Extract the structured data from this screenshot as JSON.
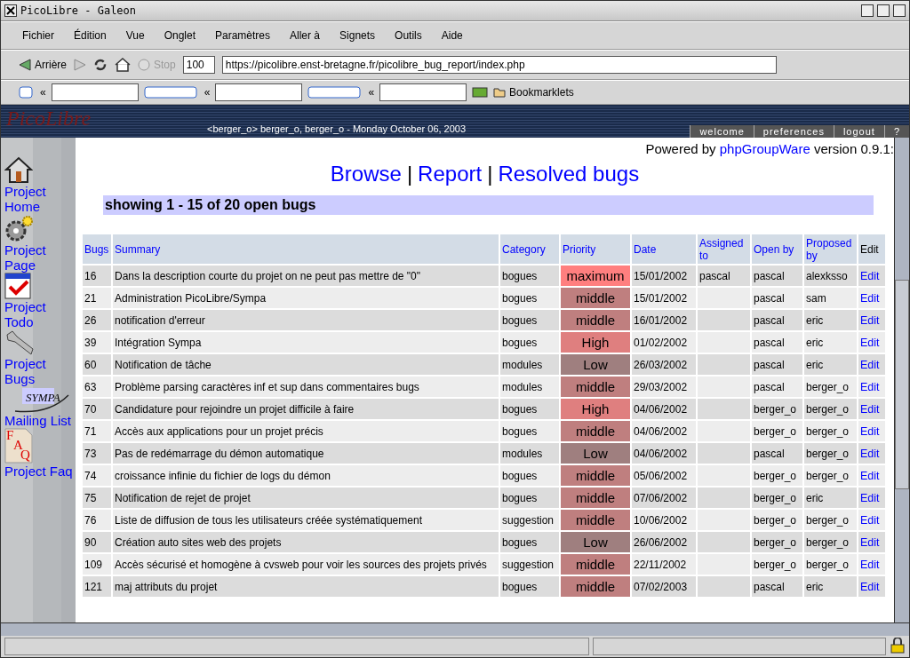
{
  "window": {
    "title": "PicoLibre - Galeon"
  },
  "menu": [
    "Fichier",
    "Édition",
    "Vue",
    "Onglet",
    "Paramètres",
    "Aller à",
    "Signets",
    "Outils",
    "Aide"
  ],
  "toolbar": {
    "back": "Arrière",
    "stop": "Stop",
    "zoom": "100",
    "url": "https://picolibre.enst-bretagne.fr/picolibre_bug_report/index.php"
  },
  "search_bar": {
    "chevrons": [
      "«",
      "«",
      "«"
    ],
    "bookmarks": "Bookmarklets"
  },
  "banner": {
    "logo": "PicoLibre",
    "user": "<berger_o> berger_o, berger_o - Monday October 06, 2003",
    "tabs": [
      "welcome",
      "preferences",
      "logout",
      "?"
    ]
  },
  "sidebar": [
    {
      "label": "Project Home",
      "kind": "home"
    },
    {
      "label": "Project Page",
      "kind": "gears"
    },
    {
      "label": "Project Todo",
      "kind": "todo"
    },
    {
      "label": "Project Bugs",
      "kind": "wrench"
    },
    {
      "label": "Mailing List",
      "kind": "sympa",
      "logo": "SYMPA"
    },
    {
      "label": "Project Faq",
      "kind": "faq",
      "logo": [
        "F",
        "A",
        "Q"
      ]
    }
  ],
  "powered": {
    "before": "Powered by",
    "link": "phpGroupWare",
    "after": "version 0.9.1:"
  },
  "nav": [
    {
      "label": "Browse"
    },
    {
      "label": "Report"
    },
    {
      "label": "Resolved bugs"
    }
  ],
  "nav_separator": "|",
  "showing": "showing 1 - 15 of 20 open bugs",
  "table": {
    "columns": [
      "Bugs",
      "Summary",
      "Category",
      "Priority",
      "Date",
      "Assigned to",
      "Open by",
      "Proposed by",
      "Edit"
    ],
    "rows": [
      {
        "id": "16",
        "summary": "Dans la description courte du projet on ne peut pas mettre de \"0\"",
        "category": "bogues",
        "priority": "maximum",
        "color": "#ff7f7f",
        "date": "15/01/2002",
        "assigned": "pascal",
        "open_by": "pascal",
        "proposed_by": "alexksso",
        "edit": "Edit"
      },
      {
        "id": "21",
        "summary": "Administration PicoLibre/Sympa",
        "category": "bogues",
        "priority": "middle",
        "color": "#bf7f7f",
        "date": "15/01/2002",
        "open_by": "pascal",
        "proposed_by": "sam",
        "edit": "Edit"
      },
      {
        "id": "26",
        "summary": "notification d'erreur",
        "category": "bogues",
        "priority": "middle",
        "color": "#bf7f7f",
        "date": "16/01/2002",
        "open_by": "pascal",
        "proposed_by": "eric",
        "edit": "Edit"
      },
      {
        "id": "39",
        "summary": "Intégration Sympa",
        "category": "bogues",
        "priority": "High",
        "color": "#df7f7f",
        "date": "01/02/2002",
        "open_by": "pascal",
        "proposed_by": "eric",
        "edit": "Edit"
      },
      {
        "id": "60",
        "summary": "Notification de tâche",
        "category": "modules",
        "priority": "Low",
        "color": "#9f7f7f",
        "date": "26/03/2002",
        "open_by": "pascal",
        "proposed_by": "eric",
        "edit": "Edit"
      },
      {
        "id": "63",
        "summary": "Problème parsing caractères inf et sup dans commentaires bugs",
        "category": "modules",
        "priority": "middle",
        "color": "#bf7f7f",
        "date": "29/03/2002",
        "open_by": "pascal",
        "proposed_by": "berger_o",
        "edit": "Edit"
      },
      {
        "id": "70",
        "summary": "Candidature pour rejoindre un projet difficile à faire",
        "category": "bogues",
        "priority": "High",
        "color": "#df7f7f",
        "date": "04/06/2002",
        "open_by": "berger_o",
        "proposed_by": "berger_o",
        "edit": "Edit"
      },
      {
        "id": "71",
        "summary": "Accès aux applications pour un projet précis",
        "category": "bogues",
        "priority": "middle",
        "color": "#bf7f7f",
        "date": "04/06/2002",
        "open_by": "berger_o",
        "proposed_by": "berger_o",
        "edit": "Edit"
      },
      {
        "id": "73",
        "summary": "Pas de redémarrage du démon automatique",
        "category": "modules",
        "priority": "Low",
        "color": "#9f7f7f",
        "date": "04/06/2002",
        "open_by": "pascal",
        "proposed_by": "berger_o",
        "edit": "Edit"
      },
      {
        "id": "74",
        "summary": "croissance infinie du fichier de logs du démon",
        "category": "bogues",
        "priority": "middle",
        "color": "#bf7f7f",
        "date": "05/06/2002",
        "open_by": "berger_o",
        "proposed_by": "berger_o",
        "edit": "Edit"
      },
      {
        "id": "75",
        "summary": "Notification de rejet de projet",
        "category": "bogues",
        "priority": "middle",
        "color": "#bf7f7f",
        "date": "07/06/2002",
        "open_by": "berger_o",
        "proposed_by": "eric",
        "edit": "Edit"
      },
      {
        "id": "76",
        "summary": "Liste de diffusion de tous les utilisateurs créée systématiquement",
        "category": "suggestion",
        "priority": "middle",
        "color": "#bf7f7f",
        "date": "10/06/2002",
        "open_by": "berger_o",
        "proposed_by": "berger_o",
        "edit": "Edit"
      },
      {
        "id": "90",
        "summary": "Création auto sites web des projets",
        "category": "bogues",
        "priority": "Low",
        "color": "#9f7f7f",
        "date": "26/06/2002",
        "open_by": "berger_o",
        "proposed_by": "berger_o",
        "edit": "Edit"
      },
      {
        "id": "109",
        "summary": "Accès sécurisé et homogène à cvsweb pour voir les sources des projets privés",
        "category": "suggestion",
        "priority": "middle",
        "color": "#bf7f7f",
        "date": "22/11/2002",
        "open_by": "berger_o",
        "proposed_by": "berger_o",
        "edit": "Edit"
      },
      {
        "id": "121",
        "summary": "maj attributs du projet",
        "category": "bogues",
        "priority": "middle",
        "color": "#bf7f7f",
        "date": "07/02/2003",
        "open_by": "pascal",
        "proposed_by": "eric",
        "edit": "Edit"
      }
    ]
  }
}
